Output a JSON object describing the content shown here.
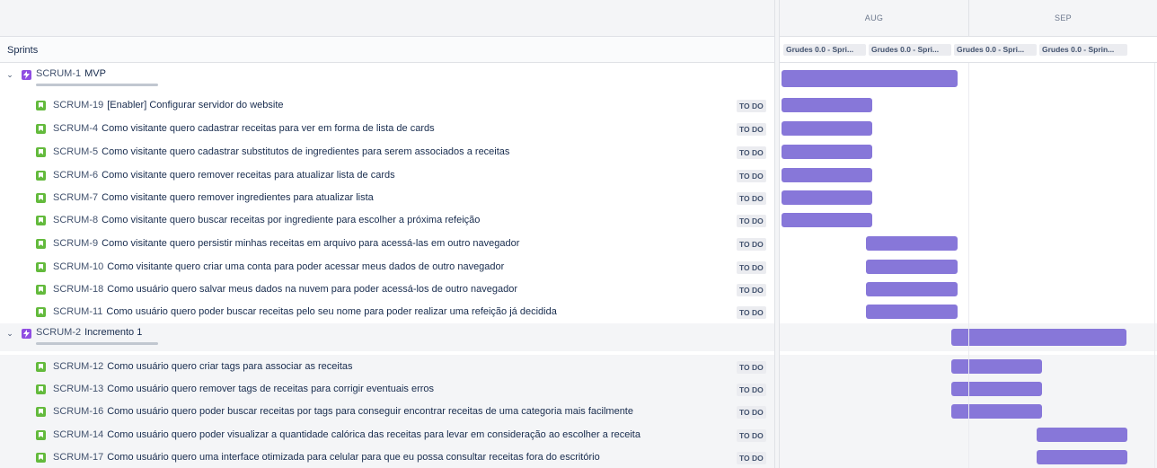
{
  "timeline": {
    "months": [
      "AUG",
      "SEP"
    ],
    "sprints": [
      "Grudes 0.0 - Spri...",
      "Grudes 0.0 - Spri...",
      "Grudes 0.0 - Spri...",
      "Grudes 0.0 - Sprin..."
    ]
  },
  "sprints_label": "Sprints",
  "colors": {
    "bar": "#8777d9",
    "epic_icon": "#904ee2",
    "story_icon": "#63ba3c"
  },
  "rows": [
    {
      "type": "epic",
      "key": "SCRUM-1",
      "title": "MVP"
    },
    {
      "type": "story",
      "key": "SCRUM-19",
      "title": "[Enabler] Configurar servidor do website",
      "status": "TO DO"
    },
    {
      "type": "story",
      "key": "SCRUM-4",
      "title": "Como visitante quero cadastrar receitas para ver em forma de lista de cards",
      "status": "TO DO"
    },
    {
      "type": "story",
      "key": "SCRUM-5",
      "title": "Como visitante quero cadastrar substitutos de ingredientes para serem associados a receitas",
      "status": "TO DO"
    },
    {
      "type": "story",
      "key": "SCRUM-6",
      "title": "Como visitante quero remover receitas para atualizar lista de cards",
      "status": "TO DO"
    },
    {
      "type": "story",
      "key": "SCRUM-7",
      "title": "Como visitante quero remover ingredientes para atualizar lista",
      "status": "TO DO"
    },
    {
      "type": "story",
      "key": "SCRUM-8",
      "title": "Como visitante quero buscar receitas por ingrediente para escolher a próxima refeição",
      "status": "TO DO"
    },
    {
      "type": "story",
      "key": "SCRUM-9",
      "title": "Como visitante quero persistir minhas receitas em arquivo para acessá-las em outro navegador",
      "status": "TO DO"
    },
    {
      "type": "story",
      "key": "SCRUM-10",
      "title": "Como visitante quero criar uma conta para poder acessar meus dados de outro navegador",
      "status": "TO DO"
    },
    {
      "type": "story",
      "key": "SCRUM-18",
      "title": "Como usuário quero salvar meus dados na nuvem para poder acessá-los de outro navegador",
      "status": "TO DO"
    },
    {
      "type": "story",
      "key": "SCRUM-11",
      "title": "Como usuário quero poder buscar receitas pelo seu nome para poder realizar uma refeição já decidida",
      "status": "TO DO"
    },
    {
      "type": "epic",
      "key": "SCRUM-2",
      "title": "Incremento 1"
    },
    {
      "type": "story",
      "key": "SCRUM-12",
      "title": "Como usuário quero criar tags para associar as receitas",
      "status": "TO DO"
    },
    {
      "type": "story",
      "key": "SCRUM-13",
      "title": "Como usuário quero remover tags de receitas para corrigir eventuais erros",
      "status": "TO DO"
    },
    {
      "type": "story",
      "key": "SCRUM-16",
      "title": "Como usuário quero poder buscar receitas por tags para conseguir encontrar receitas de uma categoria mais facilmente",
      "status": "TO DO"
    },
    {
      "type": "story",
      "key": "SCRUM-14",
      "title": "Como usuário quero poder visualizar a quantidade calórica das receitas para levar em consideração ao escolher a receita",
      "status": "TO DO"
    },
    {
      "type": "story",
      "key": "SCRUM-17",
      "title": "Como usuário quero uma interface otimizada para celular para que eu possa consultar receitas fora do escritório",
      "status": "TO DO"
    }
  ]
}
